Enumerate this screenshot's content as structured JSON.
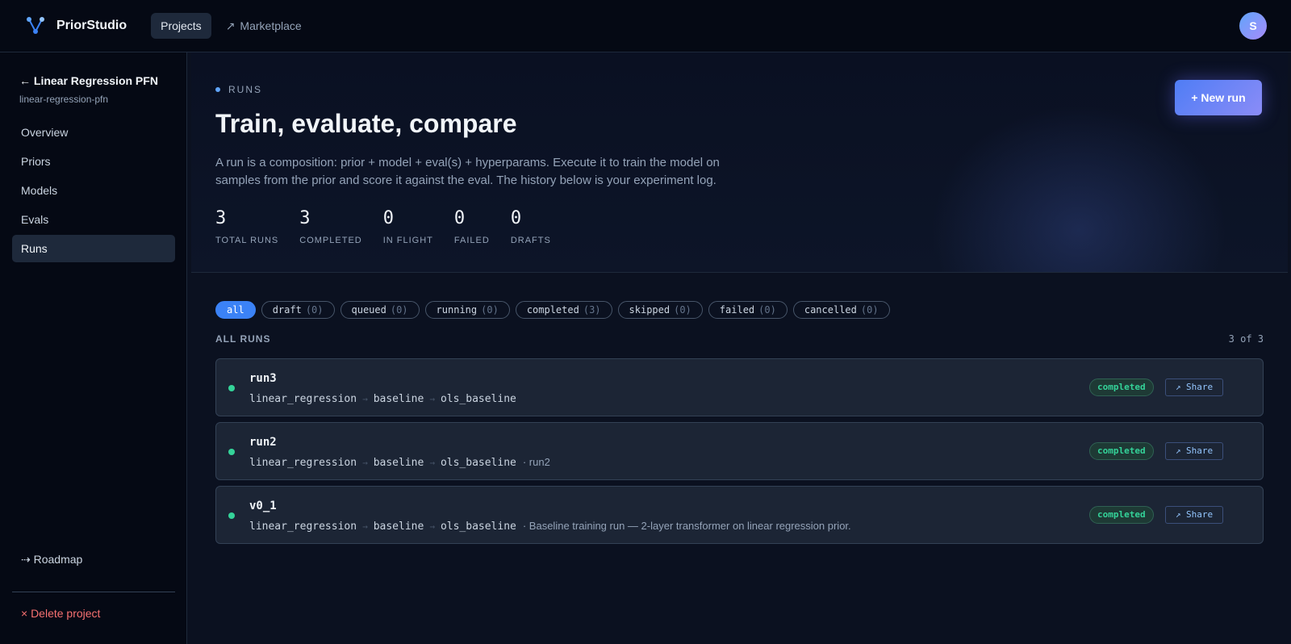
{
  "app": {
    "name": "PriorStudio",
    "avatar_initial": "S"
  },
  "nav": {
    "projects": "Projects",
    "marketplace": "Marketplace",
    "marketplace_icon": "↗"
  },
  "sidebar": {
    "back_label": "← Linear Regression PFN",
    "slug": "linear-regression-pfn",
    "items": [
      {
        "label": "Overview"
      },
      {
        "label": "Priors"
      },
      {
        "label": "Models"
      },
      {
        "label": "Evals"
      },
      {
        "label": "Runs",
        "active": true
      }
    ],
    "roadmap": "⇢ Roadmap",
    "delete": "× Delete project"
  },
  "hero": {
    "eyebrow": "RUNS",
    "title": "Train, evaluate, compare",
    "description": "A run is a composition: prior + model + eval(s) + hyperparams. Execute it to train the model on samples from the prior and score it against the eval. The history below is your experiment log.",
    "new_run": "+ New run",
    "stats": [
      {
        "value": "3",
        "label": "TOTAL RUNS"
      },
      {
        "value": "3",
        "label": "COMPLETED"
      },
      {
        "value": "0",
        "label": "IN FLIGHT"
      },
      {
        "value": "0",
        "label": "FAILED"
      },
      {
        "value": "0",
        "label": "DRAFTS"
      }
    ]
  },
  "filters": [
    {
      "label": "all",
      "count": "",
      "active": true
    },
    {
      "label": "draft",
      "count": "(0)"
    },
    {
      "label": "queued",
      "count": "(0)"
    },
    {
      "label": "running",
      "count": "(0)"
    },
    {
      "label": "completed",
      "count": "(3)"
    },
    {
      "label": "skipped",
      "count": "(0)"
    },
    {
      "label": "failed",
      "count": "(0)"
    },
    {
      "label": "cancelled",
      "count": "(0)"
    }
  ],
  "runs_section": {
    "title": "ALL RUNS",
    "count": "3 of 3"
  },
  "runs": [
    {
      "name": "run3",
      "prior": "linear_regression",
      "model": "baseline",
      "eval": "ols_baseline",
      "note": "",
      "status": "completed",
      "share": "↗ Share"
    },
    {
      "name": "run2",
      "prior": "linear_regression",
      "model": "baseline",
      "eval": "ols_baseline",
      "note": "· run2",
      "status": "completed",
      "share": "↗ Share"
    },
    {
      "name": "v0_1",
      "prior": "linear_regression",
      "model": "baseline",
      "eval": "ols_baseline",
      "note": "· Baseline training run — 2-layer transformer on linear regression prior.",
      "status": "completed",
      "share": "↗ Share"
    }
  ],
  "colors": {
    "accent": "#3b82f6",
    "success": "#34d399",
    "danger": "#f87171",
    "background": "#0b1120"
  }
}
